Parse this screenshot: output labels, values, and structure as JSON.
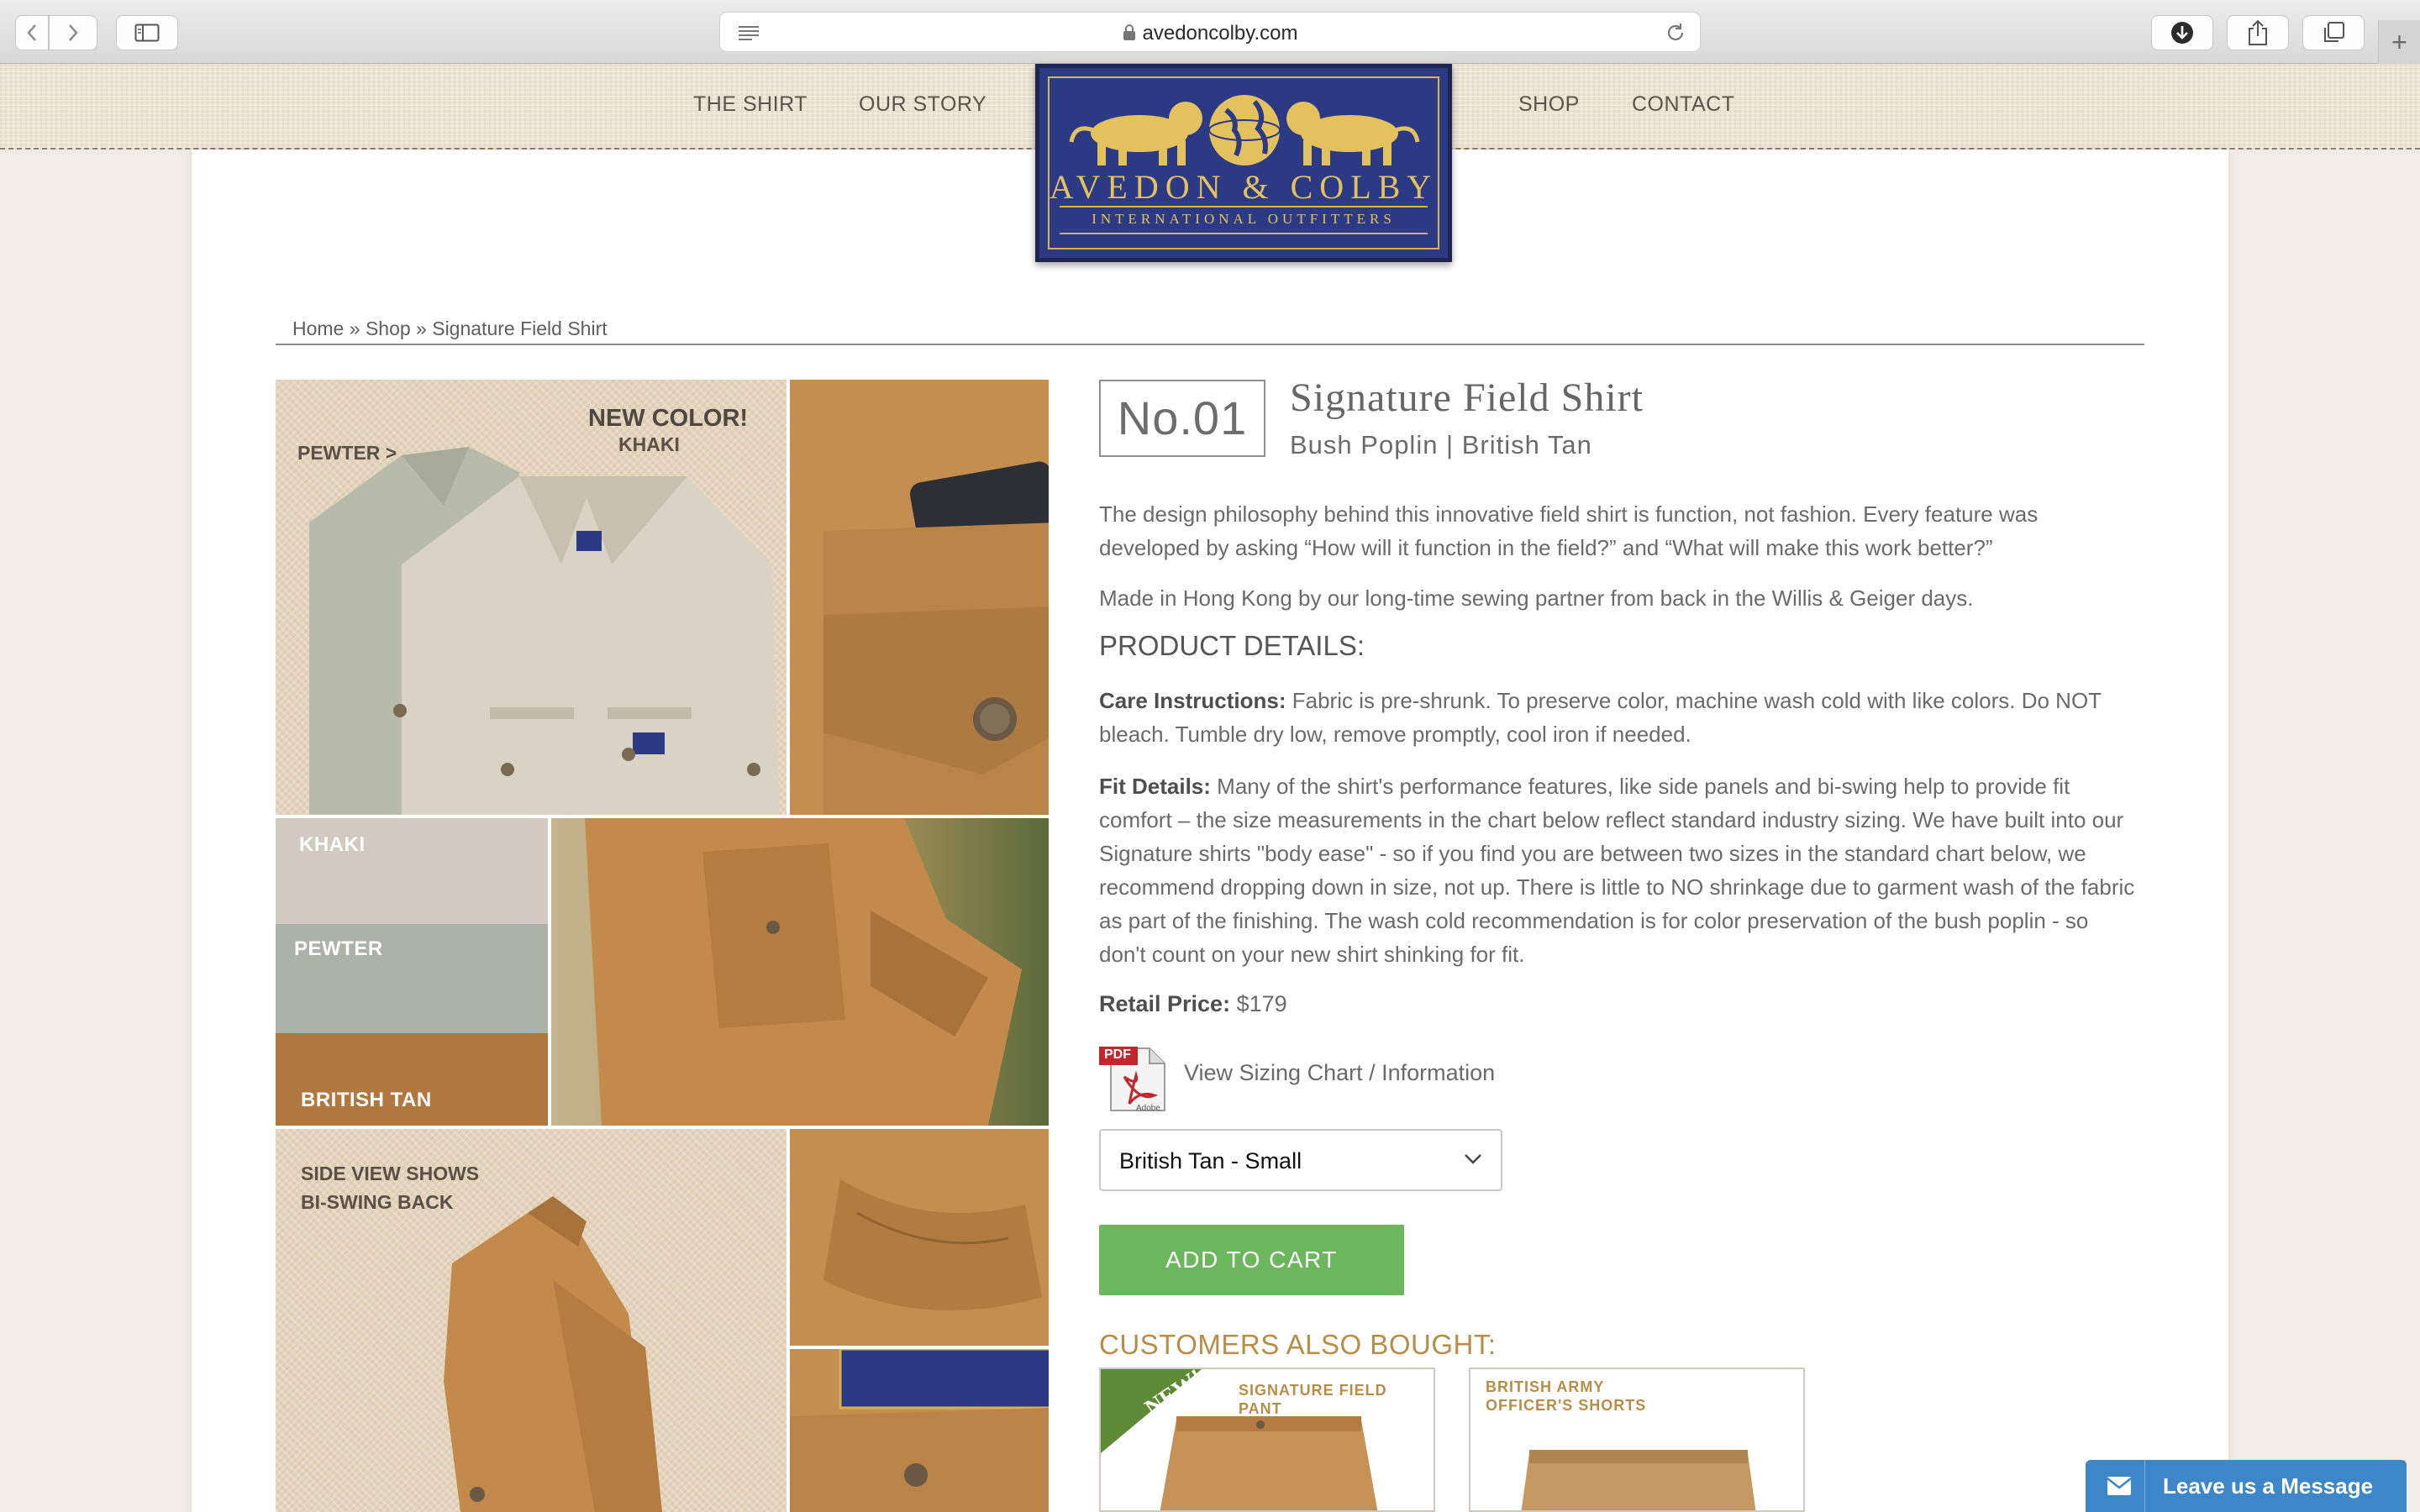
{
  "browser": {
    "url": "avedoncolby.com",
    "new_tab": "+"
  },
  "nav": {
    "left": [
      "THE SHIRT",
      "OUR STORY"
    ],
    "right": [
      "SHOP",
      "CONTACT"
    ]
  },
  "logo": {
    "brand": "AVEDON & COLBY",
    "tagline": "INTERNATIONAL OUTFITTERS"
  },
  "breadcrumb": {
    "home": "Home",
    "sep": "»",
    "shop": "Shop",
    "current": "Signature Field Shirt"
  },
  "collage": {
    "pewter_label": "PEWTER >",
    "new_color": "NEW COLOR!",
    "new_color_name": "KHAKI",
    "swatch_khaki": "KHAKI",
    "swatch_pewter": "PEWTER",
    "swatch_tan": "BRITISH TAN",
    "side_view_1": "SIDE VIEW SHOWS",
    "side_view_2": "BI-SWING BACK"
  },
  "product": {
    "number": "No.01",
    "title": "Signature Field Shirt",
    "subtitle": "Bush Poplin | British Tan",
    "description": "The design philosophy behind this innovative field shirt is function, not fashion. Every feature was developed by asking “How will it function in the field?” and “What will make this work better?”",
    "made_in": "Made in Hong Kong by our long-time sewing partner from back in the Willis & Geiger days.",
    "details_heading": "PRODUCT DETAILS:",
    "care_label": "Care Instructions:",
    "care_text": "Fabric is pre-shrunk. To preserve color, machine wash cold with like colors. Do NOT bleach. Tumble dry low, remove promptly, cool iron if needed.",
    "fit_label": "Fit Details:",
    "fit_text": "Many of the shirt's performance features, like side panels and bi-swing help to provide fit comfort – the size measurements in the chart below reflect standard industry sizing. We have built into our Signature shirts \"body ease\" - so if you find you are between two sizes in the standard chart below, we recommend dropping down in size, not up. There is little to NO shrinkage due to garment wash of the fabric as part of the finishing. The wash cold recommendation is for color preservation of the bush poplin - so don't count on your new shirt shinking for fit.",
    "price_label": "Retail Price:",
    "price_value": "$179",
    "pdf_label": "PDF",
    "pdf_brand": "Adobe",
    "sizing_link": "View Sizing Chart / Information",
    "selected_option": "British Tan - Small",
    "add_to_cart": "ADD TO CART"
  },
  "also_bought": {
    "heading": "CUSTOMERS ALSO BOUGHT:",
    "items": [
      {
        "badge": "NEW!",
        "label": "SIGNATURE FIELD PANT"
      },
      {
        "label_line1": "BRITISH ARMY",
        "label_line2": "OFFICER'S SHORTS"
      }
    ]
  },
  "chat": {
    "label": "Leave us a Message"
  },
  "colors": {
    "accent_green": "#6cb75d",
    "heading_gold": "#b88d47",
    "logo_navy": "#2c3a86",
    "chat_blue": "#3d86c8"
  }
}
